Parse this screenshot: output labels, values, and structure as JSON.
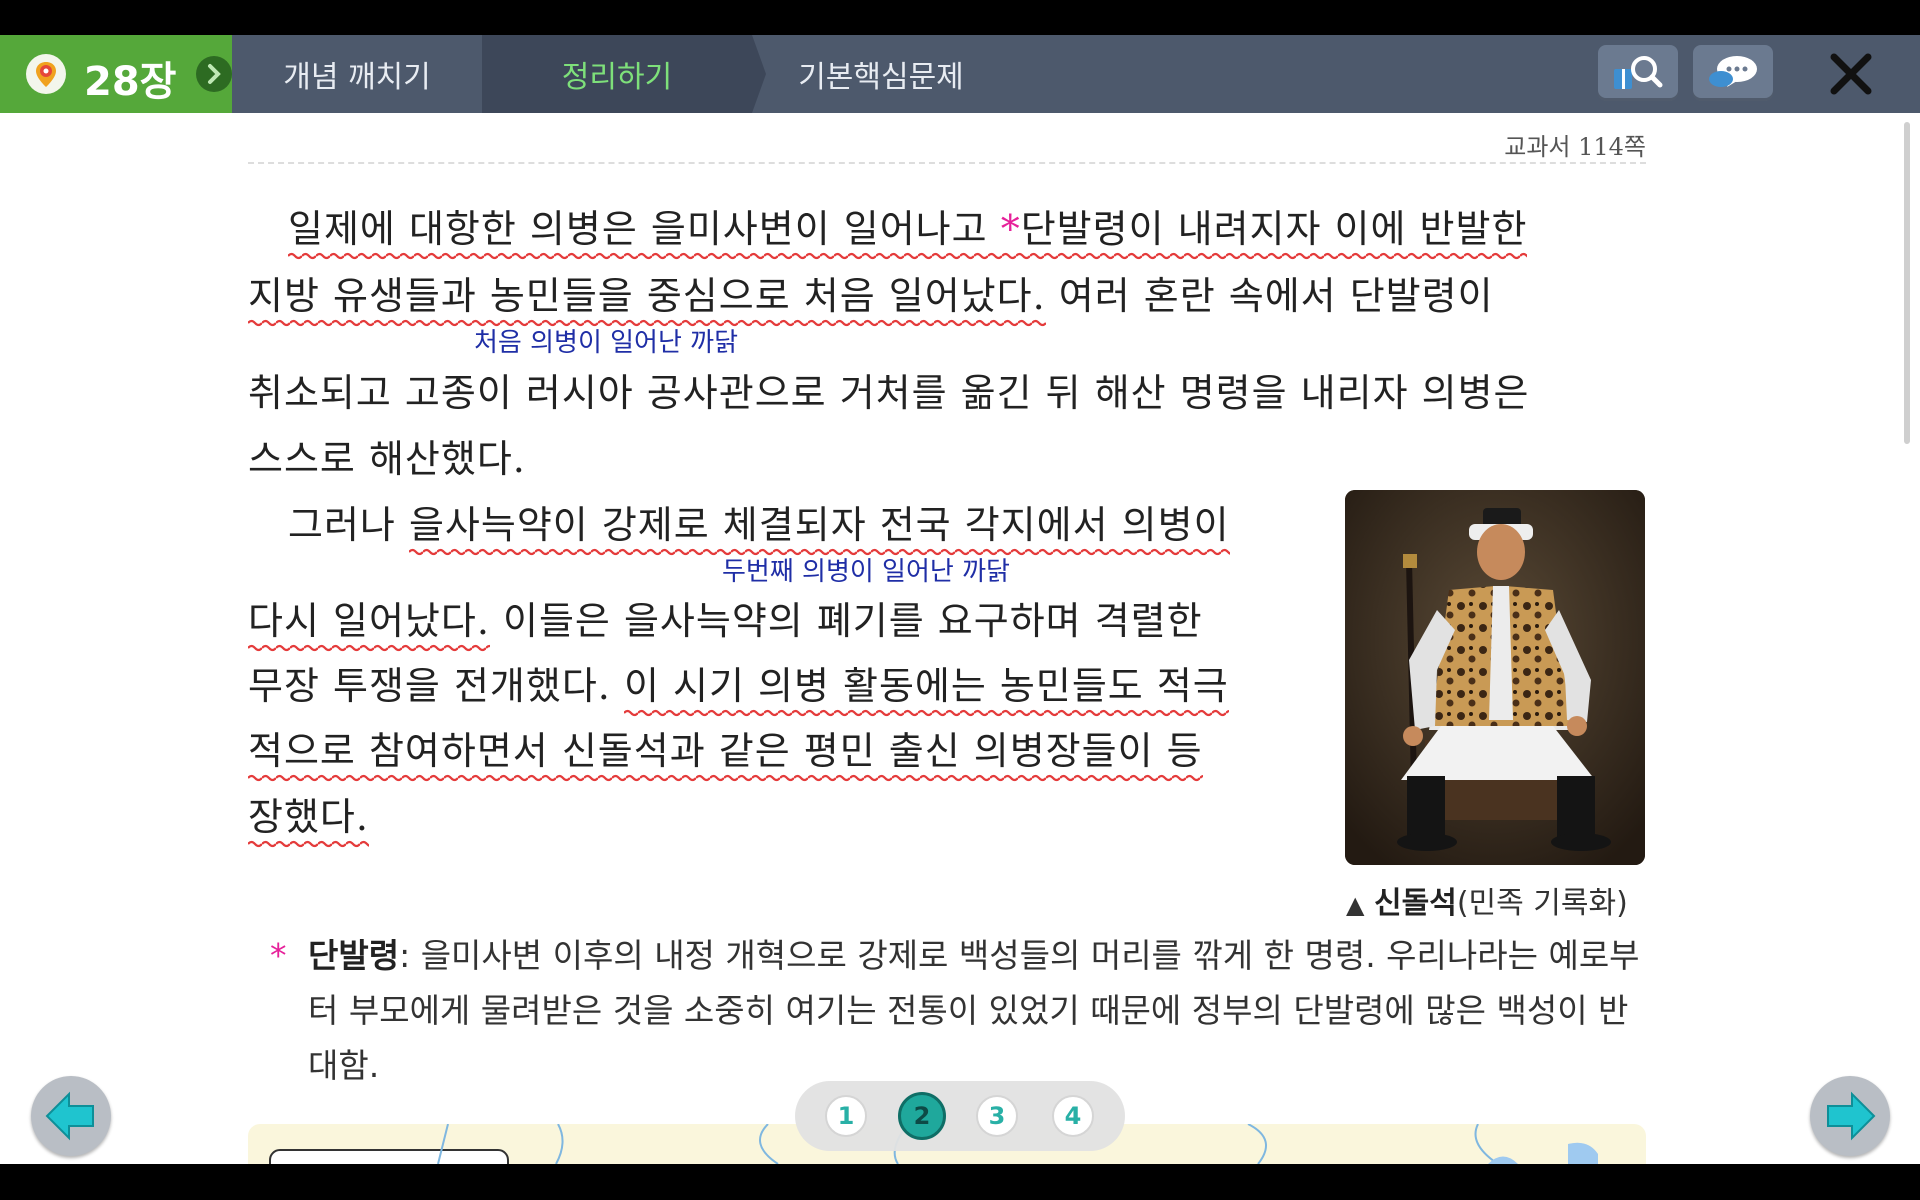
{
  "navbar": {
    "chapter": "28장",
    "tabs": [
      {
        "label": "개념 깨치기"
      },
      {
        "label": "정리하기"
      },
      {
        "label": "기본핵심문제"
      }
    ]
  },
  "page_ref": "교과서 114쪽",
  "paragraph1": {
    "line1_a": "일제에 대항한 의병은 을미사변이 일어나고 ",
    "line1_star": "*",
    "line1_b": "단발령이 내려지자 이에 반발한",
    "line2_a": "지방 유생들과 농민들을 중심으로 처음 일어났다.",
    "line2_b": " 여러 혼란 속에서 단발령이",
    "note": "처음 의병이 일어난 까닭",
    "line3": "취소되고 고종이 러시아 공사관으로 거처를 옮긴 뒤 해산 명령을 내리자 의병은",
    "line4": "스스로 해산했다."
  },
  "paragraph2": {
    "line1_a": "그러나 ",
    "line1_b": "을사늑약이 강제로 체결되자 전국 각지에서 의병이",
    "note": "두번째 의병이 일어난 까닭",
    "line2_a": "다시 일어났다.",
    "line2_b": " 이들은 을사늑약의 폐기를 요구하며 격렬한",
    "line3_a": "무장 투쟁을 전개했다. ",
    "line3_b": "이 시기 의병 활동에는 농민들도 적극",
    "line4": "적으로 참여하면서 신돌석과 같은 평민 출신 의병장들이 등",
    "line5": "장했다."
  },
  "caption": {
    "marker": "▲",
    "name": "신돌석",
    "desc": "(민족 기록화)"
  },
  "footnote": {
    "star": "*",
    "term": "단발령",
    "text": ": 을미사변 이후의 내정 개혁으로 강제로 백성들의 머리를 깎게 한 명령. 우리나라는 예로부터 부모에게 물려받은 것을 소중히 여기는 전통이 있었기 때문에 정부의 단발령에 많은 백성이 반대함."
  },
  "pager": {
    "pages": [
      "1",
      "2",
      "3",
      "4"
    ],
    "current": "2"
  },
  "colors": {
    "navbar": "#4d596c",
    "chapter": "#55a83a",
    "active_tab_text": "#7ee07a",
    "underline": "#e43b3b",
    "note": "#1f2ea6",
    "accent": "#1fa89c"
  },
  "icons": {
    "chapter": "map-pin-icon",
    "chapter_next": "chevron-right-icon",
    "search": "book-search-icon",
    "chat": "chat-bubble-icon",
    "close": "close-icon",
    "prev": "arrow-left-icon",
    "next": "arrow-right-icon"
  }
}
